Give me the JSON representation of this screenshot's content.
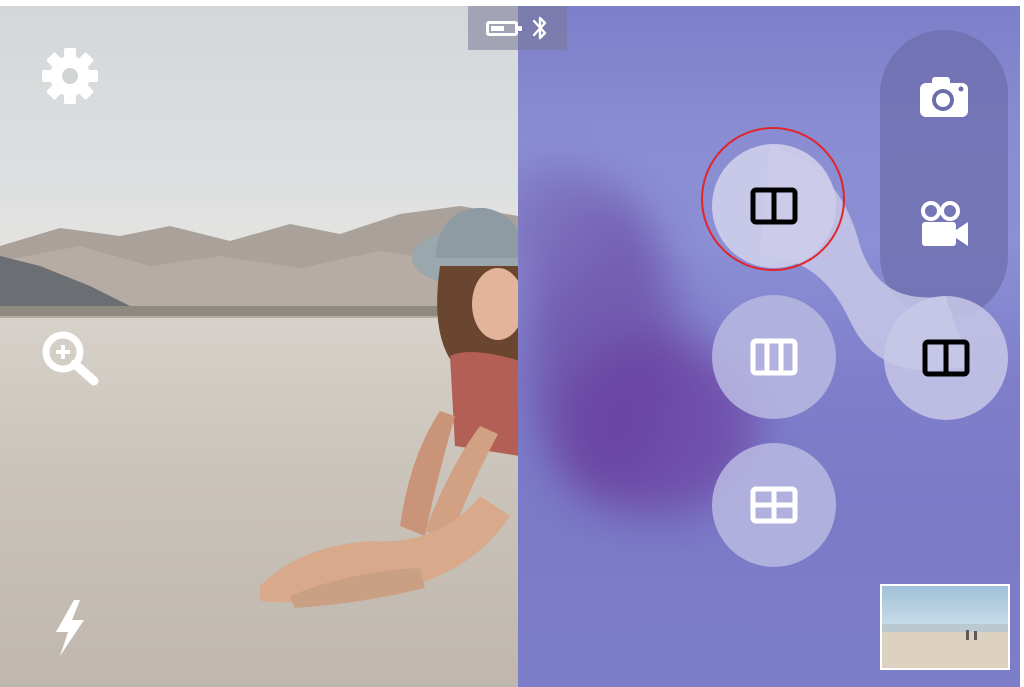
{
  "app": {
    "accent_color": "#e0262b",
    "panel_color": "#8a8dd2"
  },
  "status_bar": {
    "icons": [
      "battery-icon",
      "bluetooth-icon"
    ]
  },
  "left_controls": {
    "icons": [
      "settings-gear-icon",
      "zoom-in-icon",
      "flash-icon"
    ]
  },
  "capture_modes": {
    "icons": [
      "photo-camera-icon",
      "video-camera-icon",
      "split-two-layout-icon"
    ]
  },
  "layout_options": {
    "selected": "split-two-layout-icon",
    "icons": [
      "split-two-layout-icon",
      "split-three-layout-icon",
      "grid-four-layout-icon"
    ]
  },
  "gallery": {
    "icon": "gallery-thumbnail"
  }
}
